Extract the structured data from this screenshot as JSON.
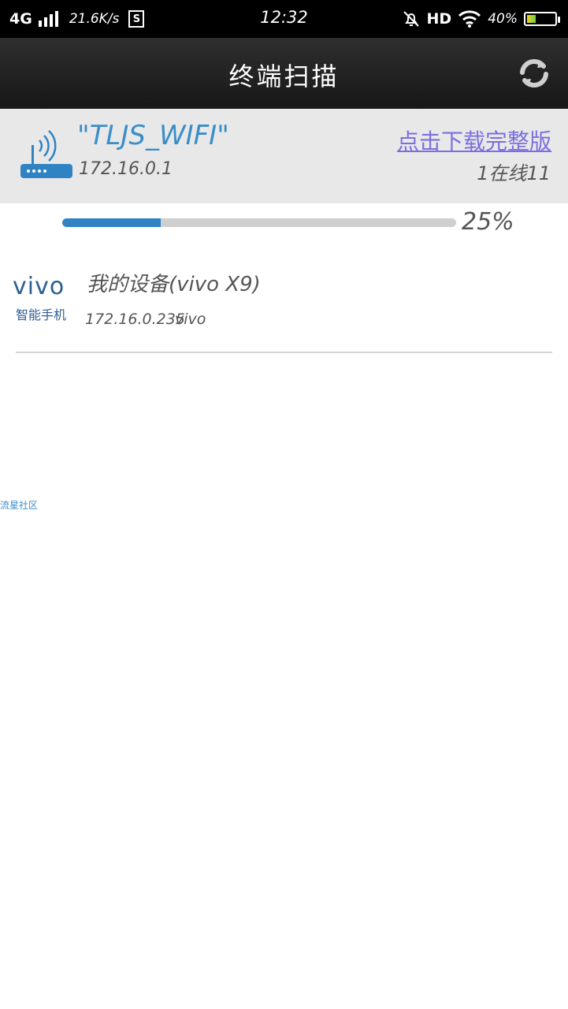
{
  "status_bar": {
    "network": "4G",
    "speed": "21.6K/s",
    "badge": "S",
    "time": "12:32",
    "hd": "HD",
    "battery_text": "40%",
    "battery_level": 0.4,
    "icons": [
      "signal-icon",
      "mute-bell-icon",
      "wifi-icon",
      "battery-icon"
    ]
  },
  "header": {
    "title": "终端扫描",
    "refresh_icon": "refresh-icon"
  },
  "wifi": {
    "ssid": "\"TLJS_WIFI\"",
    "gateway_ip": "172.16.0.1",
    "download_link": "点击下载完整版",
    "online_count": "1在线11",
    "icon": "router-icon",
    "accent_color": "#3a8ec8"
  },
  "scan": {
    "progress_text": "25%",
    "progress_value": 0.25,
    "bar_color": "#2f83c4"
  },
  "devices": [
    {
      "logo_text": "vivo",
      "logo_sub": "智能手机",
      "name": "我的设备(vivo X9)",
      "ip": "172.16.0.235",
      "vendor": "vivo"
    }
  ],
  "watermark": "流星社区"
}
